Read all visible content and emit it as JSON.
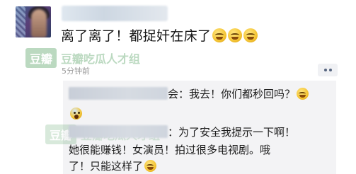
{
  "post": {
    "content": "离了离了！都捉奸在床了",
    "timestamp": "5分钟前"
  },
  "watermark": {
    "logo": "豆瓣",
    "text": "豆瓣吃瓜人才组"
  },
  "replies": [
    {
      "text_line1": "会：我去！你们都秒回吗？"
    },
    {
      "text_line1": "：为了安全我提示一下啊！",
      "text_line2": "她很能赚钱！女演员！拍过很多电视剧。哦",
      "text_line3": "了！只能这样了"
    }
  ],
  "icons": {
    "emoji": "laughing-tears-emoji",
    "scream": "screaming-face-emoji",
    "more": "ellipsis-icon"
  }
}
